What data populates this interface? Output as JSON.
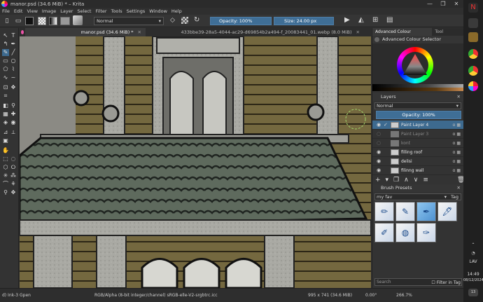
{
  "window": {
    "title": "manor.psd (34.6 MiB) * – Krita",
    "min": "—",
    "max": "❐",
    "close": "✕"
  },
  "menu": [
    "File",
    "Edit",
    "View",
    "Image",
    "Layer",
    "Select",
    "Filter",
    "Tools",
    "Settings",
    "Window",
    "Help"
  ],
  "toolbar": {
    "blend_mode": "Normal",
    "opacity": "Opacity: 100%",
    "size": "Size: 24.00 px"
  },
  "tabs": [
    {
      "label": "manor.psd (34.6 MiB) *",
      "active": true
    },
    {
      "label": "433bbe39-28a5-4044-ac29-d69854b2a494-f_20083441_01.webp (8.0 MiB)",
      "active": false
    }
  ],
  "dock": {
    "color_tabs": [
      "Advanced Colour Selector",
      "Tool Options"
    ],
    "color_panel_title": "Advanced Colour Selector",
    "layers_title": "Layers",
    "layer_blend": "Normal",
    "layer_opacity": "Opacity: 100%",
    "layers": [
      {
        "name": "Paint Layer 4",
        "selected": true,
        "visible": true,
        "dim": false
      },
      {
        "name": "Paint Layer 3",
        "selected": false,
        "visible": false,
        "dim": true
      },
      {
        "name": "kont",
        "selected": false,
        "visible": false,
        "dim": true
      },
      {
        "name": "filling roof",
        "selected": false,
        "visible": true,
        "dim": false
      },
      {
        "name": "delisi",
        "selected": false,
        "visible": true,
        "dim": false
      },
      {
        "name": "filinng wall",
        "selected": false,
        "visible": true,
        "dim": false
      }
    ],
    "brush_title": "Brush Presets",
    "brush_filter": "my fav",
    "brush_tag": "Tag",
    "search_placeholder": "Search",
    "filter_in_tag": "Filter in Tag"
  },
  "status": {
    "brush": "d) Ink-3 Gpen",
    "color_profile": "RGB/Alpha (8-bit integer/channel)  sRGB-elle-V2-srgbtrc.icc",
    "dimensions": "995 x 741 (34.6 MiB)",
    "rotation": "0.00°",
    "zoom": "266.7%"
  },
  "taskbar": {
    "language": "LAV",
    "time": "14:49",
    "date": "08/12/2024",
    "badge": "13"
  }
}
